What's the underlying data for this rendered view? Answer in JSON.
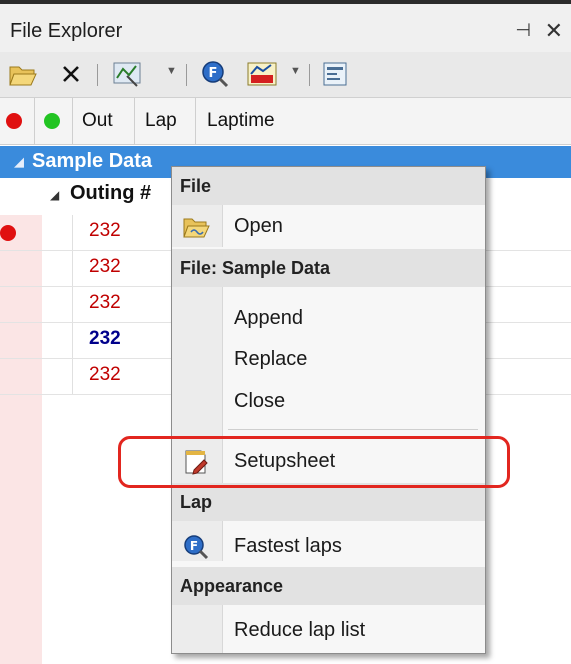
{
  "window": {
    "title": "File Explorer",
    "pin_glyph": "⊣",
    "close_glyph": "✕"
  },
  "toolbar": {
    "icons": [
      "open-folder-icon",
      "delete-icon",
      "channels-icon",
      "fastest-lap-icon",
      "chart-icon",
      "sheet-icon"
    ]
  },
  "columns": {
    "out": "Out",
    "lap": "Lap",
    "laptime": "Laptime"
  },
  "tree": {
    "root_label": "Sample Data",
    "outing_label": "Outing #",
    "rows": [
      {
        "value": "232",
        "color": "#c00000",
        "marked": true,
        "bold": false
      },
      {
        "value": "232",
        "color": "#c00000",
        "marked": false,
        "bold": false
      },
      {
        "value": "232",
        "color": "#c00000",
        "marked": false,
        "bold": false
      },
      {
        "value": "232",
        "color": "#00008b",
        "marked": false,
        "bold": true
      },
      {
        "value": "232",
        "color": "#c00000",
        "marked": false,
        "bold": false
      }
    ]
  },
  "context_menu": {
    "sections": {
      "file": "File",
      "file_sample": "File: Sample Data",
      "lap": "Lap",
      "appearance": "Appearance"
    },
    "items": {
      "open": "Open",
      "append": "Append",
      "replace": "Replace",
      "close": "Close",
      "setupsheet": "Setupsheet",
      "fastest_laps": "Fastest laps",
      "reduce_lap_list": "Reduce lap list"
    }
  },
  "colors": {
    "selection": "#3a8bdc",
    "highlight": "#e2261f",
    "red_dot": "#e01010",
    "green_dot": "#22c422"
  }
}
